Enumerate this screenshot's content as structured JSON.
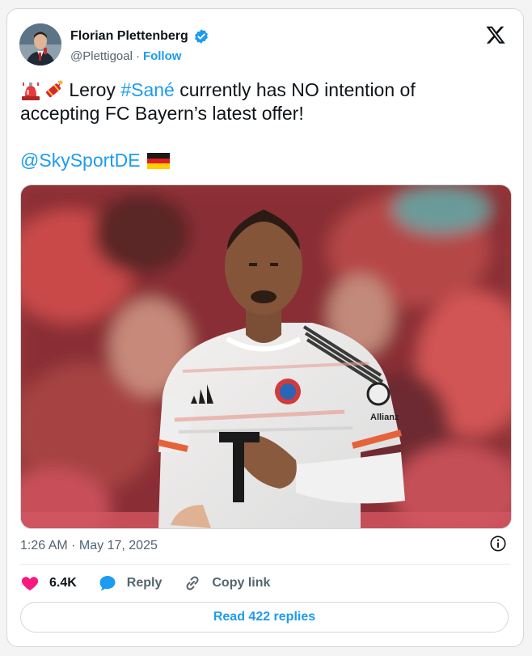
{
  "author": {
    "name": "Florian Plettenberg",
    "handle": "@Plettigoal",
    "separator": "·",
    "follow_label": "Follow"
  },
  "tweet": {
    "line1_text": " Leroy ",
    "hashtag": "#Sané",
    "line1_rest": " currently has NO intention of",
    "line2": "accepting FC Bayern’s latest offer!",
    "mention": "@SkySportDE",
    "emoji_icons": [
      "rotating-light-icon",
      "firecracker-icon",
      "germany-flag-icon"
    ]
  },
  "media": {
    "kind": "photo",
    "shirt_sponsor": "Allianz"
  },
  "meta": {
    "timestamp": "1:26 AM · May 17, 2025"
  },
  "actions": {
    "likes": "6.4K",
    "reply_label": "Reply",
    "copy_link_label": "Copy link"
  },
  "read_replies_label": "Read 422 replies",
  "colors": {
    "accent": "#1d9bf0",
    "like": "#f91880",
    "text": "#0f1419",
    "muted": "#536471"
  }
}
